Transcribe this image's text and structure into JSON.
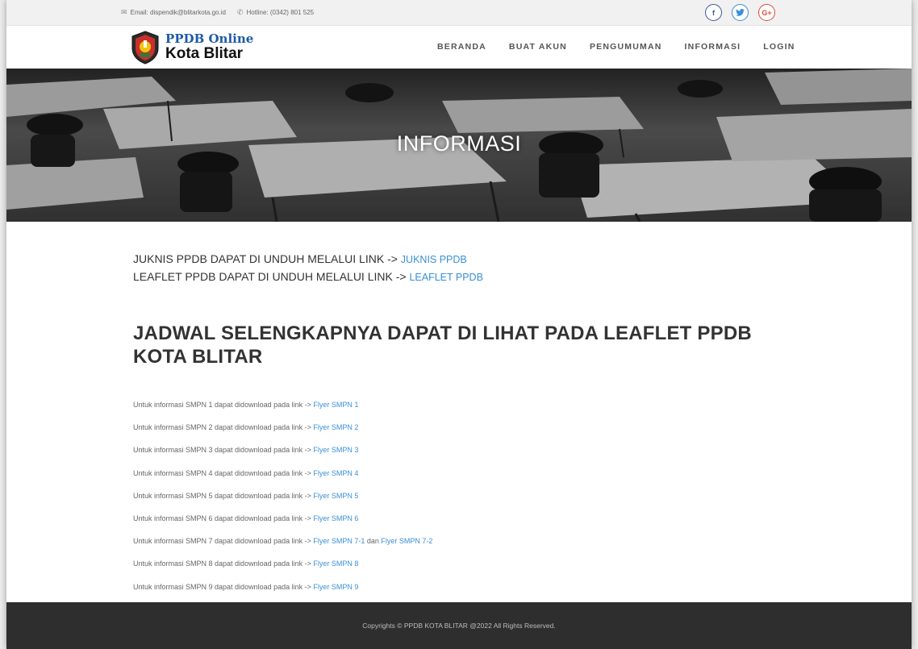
{
  "topbar": {
    "email": "Email: dispendik@blitarkota.go.id",
    "hotline": "Hotline: (0342) 801 525",
    "social": [
      {
        "icon": "facebook-icon",
        "glyph": "f"
      },
      {
        "icon": "twitter-icon",
        "glyph": "t"
      },
      {
        "icon": "google-plus-icon",
        "glyph": "G+"
      }
    ]
  },
  "brand": {
    "line1": "PPDB Online",
    "line2": "Kota Blitar"
  },
  "nav": {
    "items": [
      "BERANDA",
      "BUAT AKUN",
      "PENGUMUMAN",
      "INFORMASI",
      "LOGIN"
    ]
  },
  "hero": {
    "title": "INFORMASI"
  },
  "downloads": [
    {
      "text": "JUKNIS PPDB DAPAT DI UNDUH MELALUI LINK -> ",
      "link": "JUKNIS PPDB"
    },
    {
      "text": "LEAFLET PPDB DAPAT DI UNDUH MELALUI LINK -> ",
      "link": "LEAFLET PPDB"
    }
  ],
  "schedule_title": "JADWAL SELENGKAPNYA DAPAT DI LIHAT PADA LEAFLET PPDB KOTA BLITAR",
  "smpn_list": [
    {
      "text": "Untuk informasi SMPN 1 dapat didownload pada link -> ",
      "link": "Flyer SMPN 1"
    },
    {
      "text": "Untuk informasi SMPN 2 dapat didownload pada link -> ",
      "link": "Flyer SMPN 2"
    },
    {
      "text": "Untuk informasi SMPN 3 dapat didownload pada link -> ",
      "link": "Flyer SMPN 3"
    },
    {
      "text": "Untuk informasi SMPN 4 dapat didownload pada link -> ",
      "link": "Flyer SMPN 4"
    },
    {
      "text": "Untuk informasi SMPN 5 dapat didownload pada link -> ",
      "link": "Flyer SMPN 5"
    },
    {
      "text": "Untuk informasi SMPN 6 dapat didownload pada link -> ",
      "link": "Flyer SMPN 6"
    },
    {
      "text": "Untuk informasi SMPN 7 dapat didownload pada link -> ",
      "link": "Flyer SMPN 7-1",
      "mid": " dan ",
      "link2": "Flyer SMPN 7-2"
    },
    {
      "text": "Untuk informasi SMPN 8 dapat didownload pada link -> ",
      "link": "Flyer SMPN 8"
    },
    {
      "text": "Untuk informasi SMPN 9 dapat didownload pada link -> ",
      "link": "Flyer SMPN 9"
    }
  ],
  "footer": {
    "copyright": "Copyrights © PPDB KOTA BLITAR @2022 All Rights Reserved."
  },
  "colors": {
    "link": "#3a8fd6",
    "footer_bg": "#2e2e2e",
    "brand_blue": "#1d5aa8"
  }
}
